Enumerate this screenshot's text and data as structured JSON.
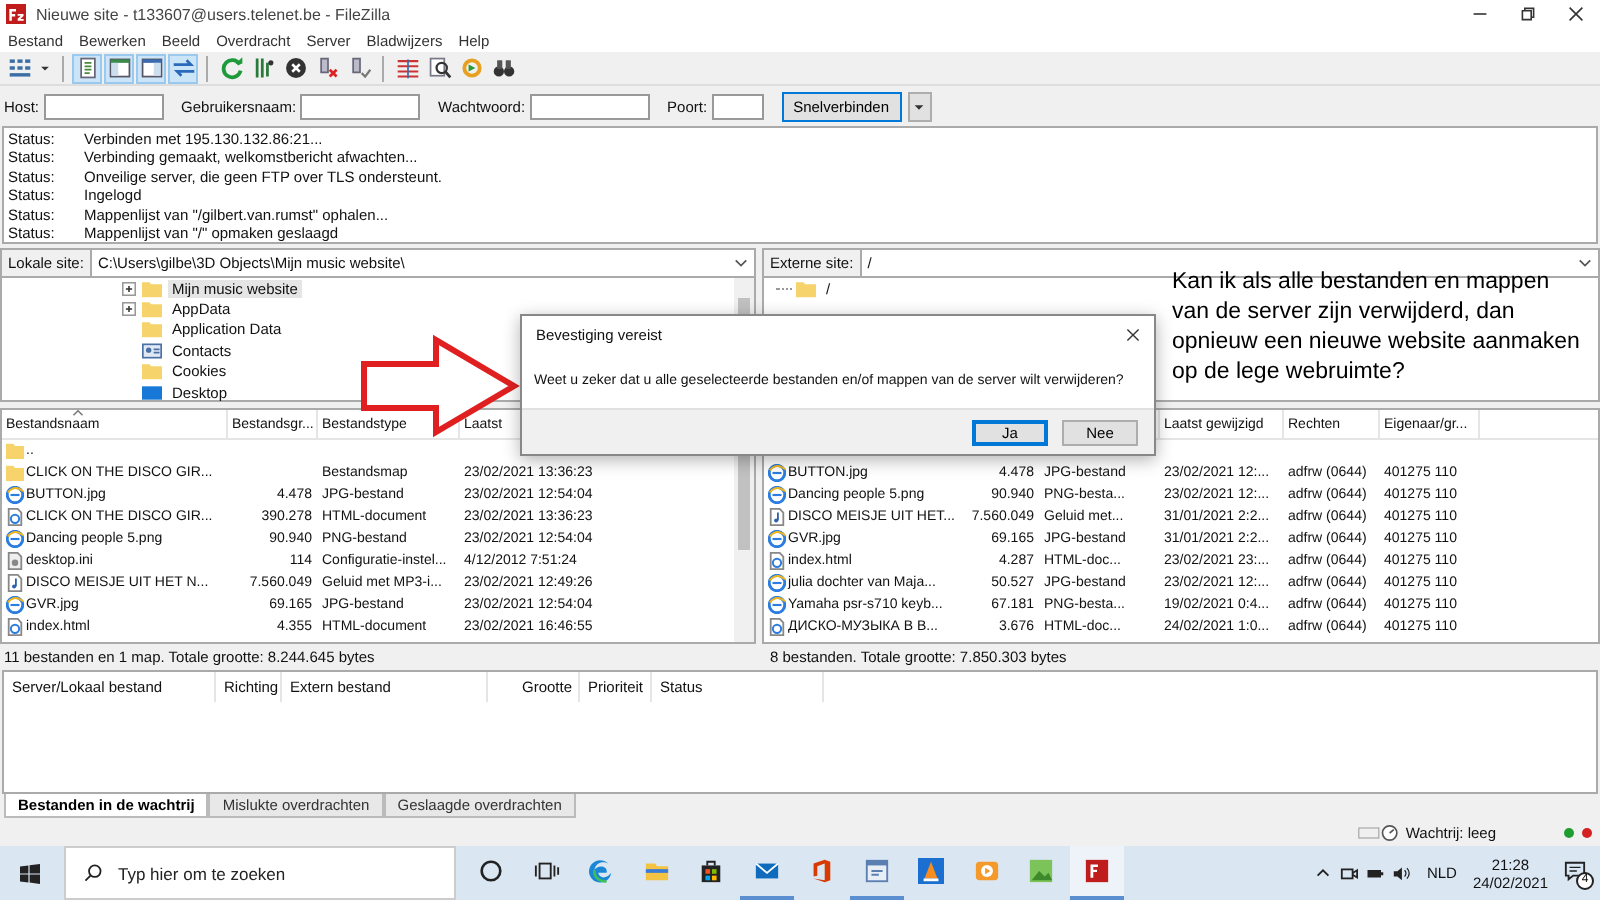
{
  "window": {
    "title": "Nieuwe site - t133607@users.telenet.be - FileZilla"
  },
  "menu": [
    "Bestand",
    "Bewerken",
    "Beeld",
    "Overdracht",
    "Server",
    "Bladwijzers",
    "Help"
  ],
  "toolbar": [
    [
      {
        "kind": "sitemanager",
        "on": false
      },
      {
        "kind": "dropdown",
        "on": false
      }
    ],
    [
      {
        "kind": "log",
        "on": true
      },
      {
        "kind": "localtree",
        "on": true
      },
      {
        "kind": "remotetree",
        "on": true
      },
      {
        "kind": "queue",
        "on": true
      }
    ],
    [
      {
        "kind": "refresh",
        "on": false
      },
      {
        "kind": "filter",
        "on": false
      },
      {
        "kind": "cancel",
        "on": false
      },
      {
        "kind": "disconnect",
        "on": false
      },
      {
        "kind": "reconnect",
        "on": false
      }
    ],
    [
      {
        "kind": "compare",
        "on": false
      },
      {
        "kind": "search",
        "on": false
      },
      {
        "kind": "sync",
        "on": false
      },
      {
        "kind": "find",
        "on": false
      }
    ]
  ],
  "quickconnect": {
    "fields": [
      {
        "label": "Host:"
      },
      {
        "label": "Gebruikersnaam:"
      },
      {
        "label": "Wachtwoord:"
      },
      {
        "label": "Poort:"
      }
    ],
    "button": "Snelverbinden"
  },
  "log": [
    {
      "label": "Status:",
      "text": "Verbinden met 195.130.132.86:21..."
    },
    {
      "label": "Status:",
      "text": "Verbinding gemaakt, welkomstbericht afwachten..."
    },
    {
      "label": "Status:",
      "text": "Onveilige server, die geen FTP over TLS ondersteunt."
    },
    {
      "label": "Status:",
      "text": "Ingelogd"
    },
    {
      "label": "Status:",
      "text": "Mappenlijst van \"/gilbert.van.rumst\" ophalen..."
    },
    {
      "label": "Status:",
      "text": "Mappenlijst van \"/\" opmaken geslaagd"
    }
  ],
  "local": {
    "label": "Lokale site:",
    "path": "C:\\Users\\gilbe\\3D Objects\\Mijn music website\\",
    "tree": [
      {
        "label": "Mijn music website",
        "kind": "folder",
        "expandable": true,
        "selected": true
      },
      {
        "label": "AppData",
        "kind": "folder",
        "expandable": true,
        "selected": false
      },
      {
        "label": "Application Data",
        "kind": "folder",
        "expandable": false,
        "selected": false
      },
      {
        "label": "Contacts",
        "kind": "contacts",
        "expandable": false,
        "selected": false
      },
      {
        "label": "Cookies",
        "kind": "folder",
        "expandable": false,
        "selected": false
      },
      {
        "label": "Desktop",
        "kind": "desktop",
        "expandable": false,
        "selected": false
      }
    ],
    "columns": [
      "Bestandsnaam",
      "Bestandsgr...",
      "Bestandstype",
      "Laatst"
    ],
    "rows": [
      {
        "name": "..",
        "kind": "folder"
      },
      {
        "name": "CLICK ON THE DISCO GIR...",
        "type": "Bestandsmap",
        "modified": "23/02/2021 13:36:23",
        "kind": "folder"
      },
      {
        "name": "BUTTON.jpg",
        "size": "4.478",
        "type": "JPG-bestand",
        "modified": "23/02/2021 12:54:04",
        "kind": "image"
      },
      {
        "name": "CLICK ON THE DISCO GIR...",
        "size": "390.278",
        "type": "HTML-document",
        "modified": "23/02/2021 13:36:23",
        "kind": "html"
      },
      {
        "name": "Dancing people 5.png",
        "size": "90.940",
        "type": "PNG-bestand",
        "modified": "23/02/2021 12:54:04",
        "kind": "image"
      },
      {
        "name": "desktop.ini",
        "size": "114",
        "type": "Configuratie-instel...",
        "modified": "4/12/2012 7:51:24",
        "kind": "ini"
      },
      {
        "name": "DISCO MEISJE UIT HET N...",
        "size": "7.560.049",
        "type": "Geluid met MP3-i...",
        "modified": "23/02/2021 12:49:26",
        "kind": "audio"
      },
      {
        "name": "GVR.jpg",
        "size": "69.165",
        "type": "JPG-bestand",
        "modified": "23/02/2021 12:54:04",
        "kind": "image"
      },
      {
        "name": "index.html",
        "size": "4.355",
        "type": "HTML-document",
        "modified": "23/02/2021 16:46:55",
        "kind": "html"
      }
    ],
    "summary": "11 bestanden en 1 map. Totale grootte: 8.244.645 bytes"
  },
  "remote": {
    "label": "Externe site:",
    "path": "/",
    "tree": [
      {
        "label": "/",
        "kind": "folder"
      }
    ],
    "columns": [
      "Laatst gewijzigd",
      "Rechten",
      "Eigenaar/gr..."
    ],
    "rows": [
      {
        "name": "BUTTON.jpg",
        "size": "4.478",
        "type": "JPG-bestand",
        "modified": "23/02/2021 12:...",
        "rights": "adfrw (0644)",
        "owner": "401275 110",
        "kind": "image"
      },
      {
        "name": "Dancing people 5.png",
        "size": "90.940",
        "type": "PNG-besta...",
        "modified": "23/02/2021 12:...",
        "rights": "adfrw (0644)",
        "owner": "401275 110",
        "kind": "image"
      },
      {
        "name": "DISCO MEISJE UIT HET...",
        "size": "7.560.049",
        "type": "Geluid met...",
        "modified": "31/01/2021 2:2...",
        "rights": "adfrw (0644)",
        "owner": "401275 110",
        "kind": "audio"
      },
      {
        "name": "GVR.jpg",
        "size": "69.165",
        "type": "JPG-bestand",
        "modified": "31/01/2021 2:2...",
        "rights": "adfrw (0644)",
        "owner": "401275 110",
        "kind": "image"
      },
      {
        "name": "index.html",
        "size": "4.287",
        "type": "HTML-doc...",
        "modified": "23/02/2021 23:...",
        "rights": "adfrw (0644)",
        "owner": "401275 110",
        "kind": "html"
      },
      {
        "name": "julia dochter van Maja...",
        "size": "50.527",
        "type": "JPG-bestand",
        "modified": "23/02/2021 12:...",
        "rights": "adfrw (0644)",
        "owner": "401275 110",
        "kind": "image"
      },
      {
        "name": "Yamaha psr-s710 keyb...",
        "size": "67.181",
        "type": "PNG-besta...",
        "modified": "19/02/2021 0:4...",
        "rights": "adfrw (0644)",
        "owner": "401275 110",
        "kind": "image"
      },
      {
        "name": "ДИСКО-МУЗЫКА В B...",
        "size": "3.676",
        "type": "HTML-doc...",
        "modified": "24/02/2021 1:0...",
        "rights": "adfrw (0644)",
        "owner": "401275 110",
        "kind": "html"
      }
    ],
    "summary": "8 bestanden. Totale grootte: 7.850.303 bytes"
  },
  "annotation": "Kan ik als alle bestanden en mappen van de server zijn verwijderd, dan opnieuw een nieuwe website aanmaken op de lege webruimte?",
  "dialog": {
    "title": "Bevestiging vereist",
    "message": "Weet u zeker dat u alle geselecteerde bestanden en/of mappen van de server wilt verwijderen?",
    "buttons": [
      {
        "label": "Ja",
        "focused": true
      },
      {
        "label": "Nee",
        "focused": false
      }
    ]
  },
  "queue": {
    "columns": [
      "Server/Lokaal bestand",
      "Richting",
      "Extern bestand",
      "Grootte",
      "Prioriteit",
      "Status"
    ]
  },
  "queue_tabs": [
    {
      "label": "Bestanden in de wachtrij",
      "selected": true
    },
    {
      "label": "Mislukte overdrachten",
      "selected": false
    },
    {
      "label": "Geslaagde overdrachten",
      "selected": false
    }
  ],
  "status_bar": {
    "queue": "Wachtrij: leeg",
    "lights": [
      {
        "color": "#1e9e2e"
      },
      {
        "color": "#d42020"
      }
    ]
  },
  "taskbar": {
    "search": {
      "placeholder": "Typ hier om te zoeken"
    },
    "apps": [
      {
        "kind": "cortana",
        "running": false,
        "selected": false
      },
      {
        "kind": "taskview",
        "running": false,
        "selected": false
      },
      {
        "kind": "edge",
        "running": false,
        "selected": false
      },
      {
        "kind": "explorer",
        "running": false,
        "selected": false
      },
      {
        "kind": "store",
        "running": false,
        "selected": false
      },
      {
        "kind": "mail",
        "running": true,
        "selected": false
      },
      {
        "kind": "office",
        "running": false,
        "selected": false
      },
      {
        "kind": "window",
        "running": true,
        "selected": false
      },
      {
        "kind": "vlc",
        "running": false,
        "selected": false
      },
      {
        "kind": "player",
        "running": false,
        "selected": false
      },
      {
        "kind": "photo",
        "running": false,
        "selected": false
      },
      {
        "kind": "filezilla",
        "running": true,
        "selected": true
      }
    ],
    "language": "NLD",
    "time": "21:28",
    "date": "24/02/2021",
    "notifications": "4"
  }
}
